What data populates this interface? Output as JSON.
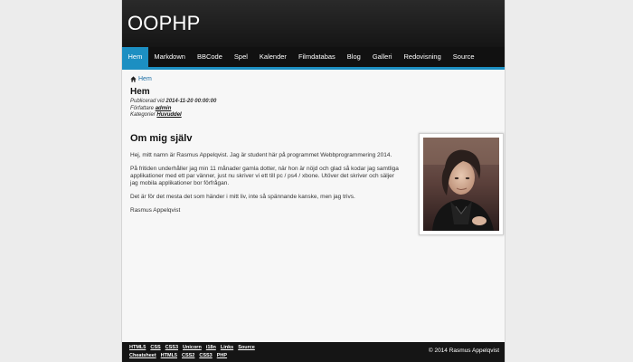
{
  "site": {
    "title": "OOPHP"
  },
  "nav": {
    "items": [
      "Hem",
      "Markdown",
      "BBCode",
      "Spel",
      "Kalender",
      "Filmdatabas",
      "Blog",
      "Galleri",
      "Redovisning",
      "Source"
    ],
    "active_index": 0
  },
  "breadcrumb": {
    "label": "Hem"
  },
  "page": {
    "heading": "Hem",
    "published_label": "Publicerad vid",
    "published_value": "2014-11-20 00:00:00",
    "author_label": "Författare",
    "author_value": "admin",
    "category_label": "Kategorier",
    "category_value": "Huvuddel"
  },
  "article": {
    "title": "Om mig själv",
    "paragraphs": [
      "Hej, mitt namn är Rasmus Appelqvist. Jag är student här på programmet Webbprogrammering 2014.",
      "På fritiden underhåller jag min 11 månader gamla dotter, när hon är nöjd och glad så kodar jag samtliga applikationer med ett par vänner, just nu skriver vi ett till pc / ps4 / xbone. Utöver det skriver och säljer jag mobila applikationer bor förfrågan.",
      "Det är för det mesta det som händer i mitt liv, inte så spännande kanske, men jag trivs.",
      "Rasmus Appelqvist"
    ]
  },
  "footer": {
    "links_row1": [
      "HTML5",
      "CSS",
      "CSS3",
      "Unicorn",
      "i18n",
      "Links",
      "Source"
    ],
    "links_row2": [
      "Cheatsheet",
      "HTML5",
      "CSS2",
      "CSS3",
      "PHP"
    ],
    "copyright": "© 2014 Rasmus Appelqvist"
  },
  "colors": {
    "accent": "#1c8fc2",
    "header_bg": "#1a1a1a",
    "page_bg": "#f7f7f7"
  },
  "icons": {
    "breadcrumb": "home-icon"
  }
}
